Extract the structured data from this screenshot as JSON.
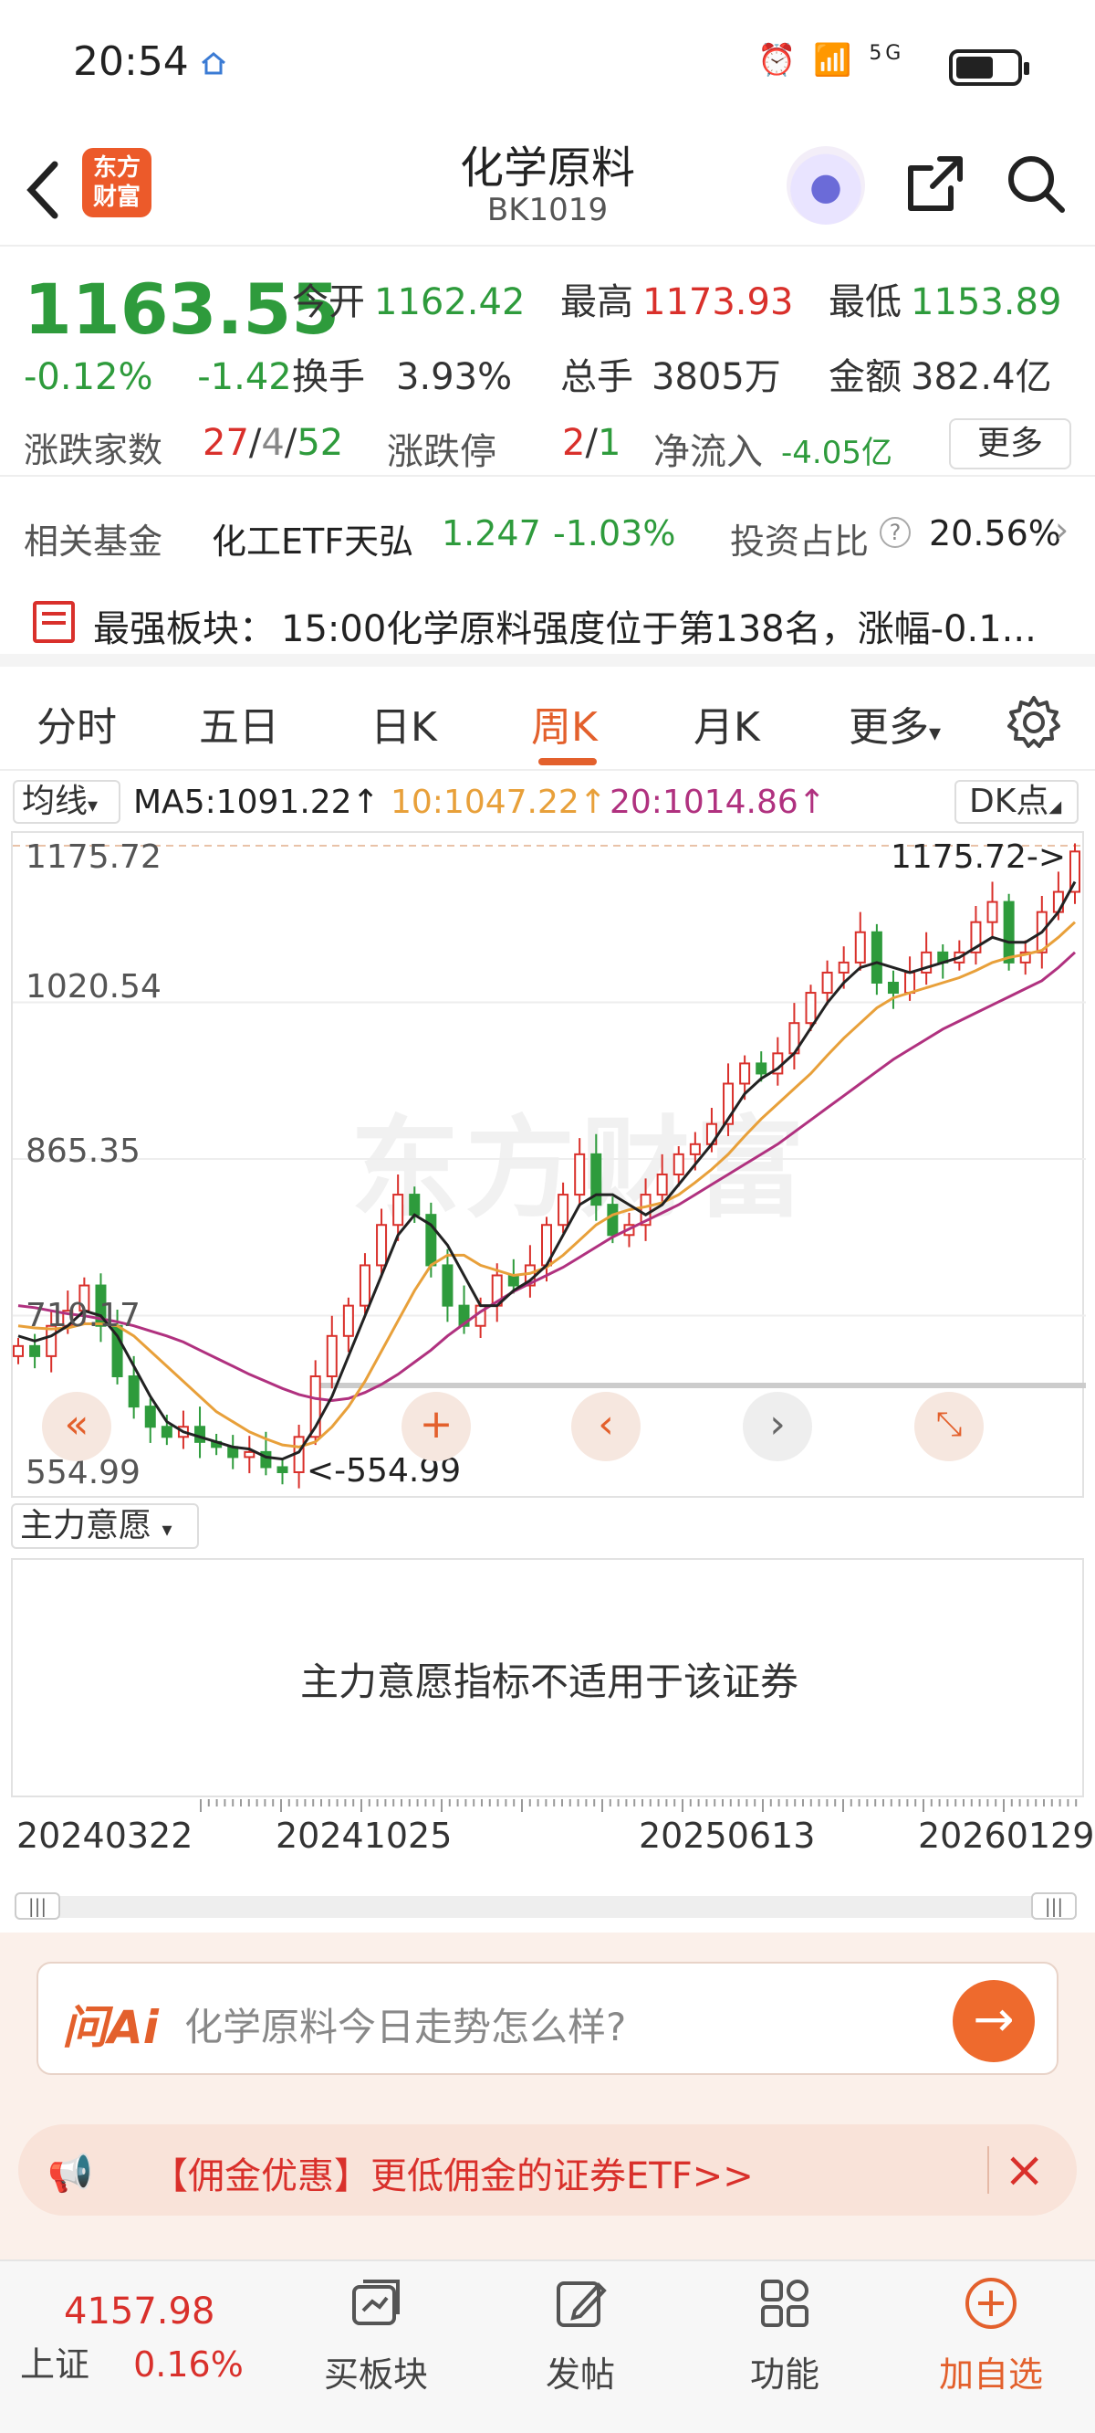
{
  "status_bar": {
    "time": "20:54",
    "network": "5G"
  },
  "header": {
    "logo": "东方\n财富",
    "title": "化学原料",
    "code": "BK1019"
  },
  "quote": {
    "price": "1163.55",
    "change_pct": "-0.12%",
    "change_abs": "-1.42",
    "open_label": "今开",
    "open": "1162.42",
    "high_label": "最高",
    "high": "1173.93",
    "low_label": "最低",
    "low": "1153.89",
    "turnover_label": "换手",
    "turnover": "3.93%",
    "volume_label": "总手",
    "volume": "3805万",
    "amount_label": "金额",
    "amount": "382.4亿",
    "breadth_label": "涨跌家数",
    "breadth_up": "27",
    "breadth_flat": "4",
    "breadth_down": "52",
    "limit_label": "涨跌停",
    "limit_up": "2",
    "limit_down": "1",
    "netflow_label": "净流入",
    "netflow": "-4.05亿",
    "more_button": "更多"
  },
  "fund": {
    "label": "相关基金",
    "name": "化工ETF天弘",
    "price": "1.247",
    "pct": "-1.03%",
    "ratio_label": "投资占比",
    "ratio": "20.56%"
  },
  "notice": {
    "label": "最强板块：",
    "text": "15:00化学原料强度位于第138名，涨幅-0.1..."
  },
  "tabs": [
    "分时",
    "五日",
    "日K",
    "周K",
    "月K",
    "更多"
  ],
  "active_tab": "周K",
  "ma": {
    "selector": "均线",
    "ma5": "MA5:1091.22↑",
    "ma10": "10:1047.22↑",
    "ma20": "20:1014.86↑",
    "dk_button": "DK点",
    "colors": {
      "ma5": "#222222",
      "ma10": "#e8a03a",
      "ma20": "#b0317f"
    }
  },
  "chart_data": {
    "type": "candlestick",
    "y_ticks": [
      "1175.72",
      "1020.54",
      "865.35",
      "710.17",
      "554.99"
    ],
    "ylim": [
      554.99,
      1175.72
    ],
    "max_marker": "1175.72->",
    "min_marker": "<-554.99",
    "colors": {
      "up": "#d9302b",
      "down": "#2e9b3c"
    },
    "closes": [
      680,
      670,
      700,
      715,
      740,
      700,
      650,
      620,
      600,
      590,
      600,
      585,
      580,
      570,
      575,
      560,
      555,
      590,
      650,
      690,
      720,
      760,
      800,
      830,
      810,
      760,
      720,
      700,
      720,
      750,
      740,
      760,
      800,
      830,
      870,
      820,
      790,
      800,
      830,
      850,
      870,
      880,
      900,
      940,
      960,
      950,
      970,
      1000,
      1030,
      1050,
      1060,
      1090,
      1040,
      1030,
      1050,
      1070,
      1060,
      1070,
      1100,
      1120,
      1060,
      1070,
      1110,
      1130,
      1170
    ],
    "ma5": [
      690,
      685,
      690,
      700,
      715,
      710,
      690,
      660,
      630,
      605,
      595,
      590,
      585,
      580,
      578,
      570,
      568,
      575,
      600,
      630,
      670,
      710,
      750,
      790,
      810,
      800,
      780,
      750,
      720,
      720,
      735,
      745,
      760,
      790,
      820,
      830,
      830,
      820,
      810,
      820,
      840,
      860,
      880,
      905,
      930,
      945,
      955,
      970,
      995,
      1020,
      1040,
      1055,
      1060,
      1055,
      1050,
      1055,
      1060,
      1065,
      1075,
      1085,
      1080,
      1080,
      1090,
      1110,
      1140
    ],
    "ma10": [
      700,
      698,
      697,
      698,
      702,
      702,
      700,
      690,
      675,
      660,
      645,
      630,
      615,
      605,
      595,
      588,
      582,
      580,
      585,
      600,
      620,
      645,
      675,
      705,
      735,
      760,
      770,
      770,
      760,
      755,
      750,
      752,
      758,
      770,
      785,
      800,
      810,
      815,
      818,
      822,
      830,
      842,
      855,
      870,
      888,
      905,
      920,
      935,
      950,
      968,
      985,
      1000,
      1015,
      1025,
      1030,
      1035,
      1040,
      1045,
      1052,
      1060,
      1065,
      1068,
      1072,
      1085,
      1100
    ],
    "ma20": [
      720,
      718,
      715,
      712,
      710,
      707,
      704,
      700,
      695,
      690,
      684,
      676,
      668,
      660,
      652,
      645,
      638,
      632,
      628,
      626,
      628,
      634,
      642,
      652,
      664,
      676,
      690,
      702,
      714,
      724,
      734,
      742,
      750,
      758,
      768,
      778,
      788,
      796,
      804,
      812,
      820,
      830,
      840,
      850,
      860,
      870,
      880,
      892,
      904,
      916,
      928,
      940,
      952,
      964,
      974,
      984,
      994,
      1002,
      1010,
      1018,
      1026,
      1034,
      1042,
      1055,
      1070
    ]
  },
  "indicator": {
    "selector": "主力意愿",
    "message": "主力意愿指标不适用于该证券"
  },
  "dates": [
    "20240322",
    "20241025",
    "20250613",
    "20260129"
  ],
  "ai": {
    "logo": "问Ai",
    "placeholder": "化学原料今日走势怎么样?"
  },
  "promo": {
    "text": "【佣金优惠】更低佣金的证券ETF>>"
  },
  "bottom": {
    "index_value": "4157.98",
    "index_name": "上证",
    "index_pct": "0.16%",
    "items": [
      "买板块",
      "发帖",
      "功能",
      "加自选"
    ]
  }
}
